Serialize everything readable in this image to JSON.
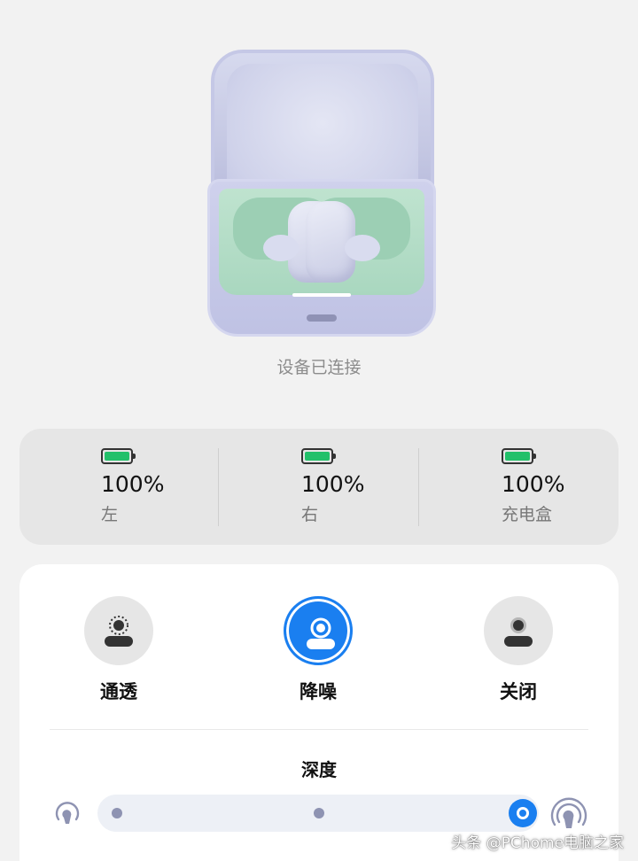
{
  "device": {
    "status": "设备已连接"
  },
  "battery": {
    "items": [
      {
        "percent_text": "100%",
        "level": 1.0,
        "label": "左"
      },
      {
        "percent_text": "100%",
        "level": 1.0,
        "label": "右"
      },
      {
        "percent_text": "100%",
        "level": 1.0,
        "label": "充电盒"
      }
    ]
  },
  "noise_modes": {
    "selected": "降噪",
    "items": [
      {
        "label": "通透",
        "icon": "transparency-icon",
        "active": false
      },
      {
        "label": "降噪",
        "icon": "noise-cancel-icon",
        "active": true
      },
      {
        "label": "关闭",
        "icon": "off-icon",
        "active": false
      }
    ]
  },
  "depth": {
    "title": "深度",
    "levels": 3,
    "selected_level": 3,
    "icon_low": "light-depth-icon",
    "icon_high": "deep-depth-icon"
  },
  "watermark": {
    "text": "头条 @PChome电脑之家"
  },
  "colors": {
    "accent": "#1a7ff0",
    "battery_green": "#22c06a",
    "background": "#f2f2f2",
    "card_gray": "#e6e6e6"
  }
}
